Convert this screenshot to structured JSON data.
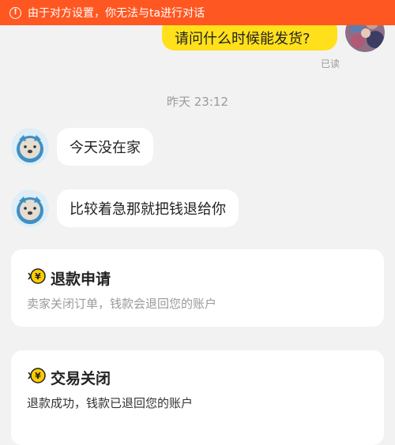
{
  "banner": {
    "icon": "exclamation-circle-icon",
    "icon_glyph": "!",
    "text": "由于对方设置，你无法与ta进行对话"
  },
  "messages": {
    "sent": {
      "text": "请问什么时候能发货?",
      "read_status": "已读",
      "avatar_icon": "user-avatar-icon"
    },
    "timestamp": "昨天 23:12",
    "received": [
      {
        "text": "今天没在家",
        "avatar_icon": "seller-avatar-icon"
      },
      {
        "text": "比较着急那就把钱退给你",
        "avatar_icon": "seller-avatar-icon"
      }
    ]
  },
  "cards": [
    {
      "icon": "refund-coin-icon",
      "title": "退款申请",
      "description": "卖家关闭订单，钱款会退回您的账户"
    },
    {
      "icon": "refund-coin-icon",
      "title": "交易关闭",
      "description": "退款成功，钱款已退回您的账户"
    }
  ],
  "colors": {
    "banner_bg": "#ff5722",
    "sent_bubble": "#ffe01a",
    "background": "#f2f2f2",
    "coin": "#ffcc00"
  }
}
